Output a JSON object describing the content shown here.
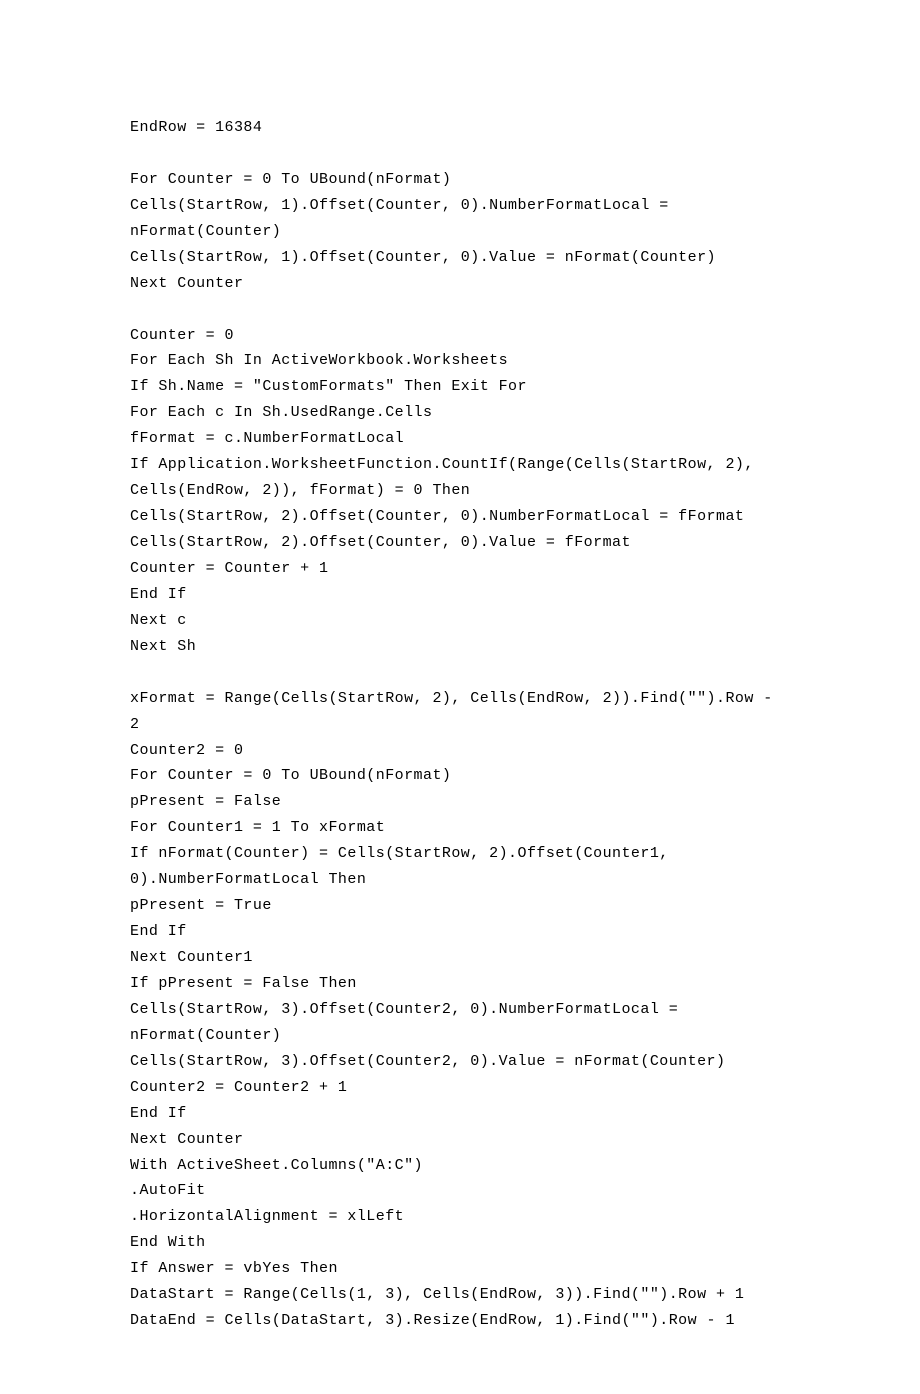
{
  "code": "EndRow = 16384\n\nFor Counter = 0 To UBound(nFormat)\nCells(StartRow, 1).Offset(Counter, 0).NumberFormatLocal = nFormat(Counter)\nCells(StartRow, 1).Offset(Counter, 0).Value = nFormat(Counter)\nNext Counter\n\nCounter = 0\nFor Each Sh In ActiveWorkbook.Worksheets\nIf Sh.Name = \"CustomFormats\" Then Exit For\nFor Each c In Sh.UsedRange.Cells\nfFormat = c.NumberFormatLocal\nIf Application.WorksheetFunction.CountIf(Range(Cells(StartRow, 2), Cells(EndRow, 2)), fFormat) = 0 Then\nCells(StartRow, 2).Offset(Counter, 0).NumberFormatLocal = fFormat\nCells(StartRow, 2).Offset(Counter, 0).Value = fFormat\nCounter = Counter + 1\nEnd If\nNext c\nNext Sh\n\nxFormat = Range(Cells(StartRow, 2), Cells(EndRow, 2)).Find(\"\").Row - 2\nCounter2 = 0\nFor Counter = 0 To UBound(nFormat)\npPresent = False\nFor Counter1 = 1 To xFormat\nIf nFormat(Counter) = Cells(StartRow, 2).Offset(Counter1, 0).NumberFormatLocal Then\npPresent = True\nEnd If\nNext Counter1\nIf pPresent = False Then\nCells(StartRow, 3).Offset(Counter2, 0).NumberFormatLocal = nFormat(Counter)\nCells(StartRow, 3).Offset(Counter2, 0).Value = nFormat(Counter)\nCounter2 = Counter2 + 1\nEnd If\nNext Counter\nWith ActiveSheet.Columns(\"A:C\")\n.AutoFit\n.HorizontalAlignment = xlLeft\nEnd With\nIf Answer = vbYes Then\nDataStart = Range(Cells(1, 3), Cells(EndRow, 3)).Find(\"\").Row + 1\nDataEnd = Cells(DataStart, 3).Resize(EndRow, 1).Find(\"\").Row - 1"
}
